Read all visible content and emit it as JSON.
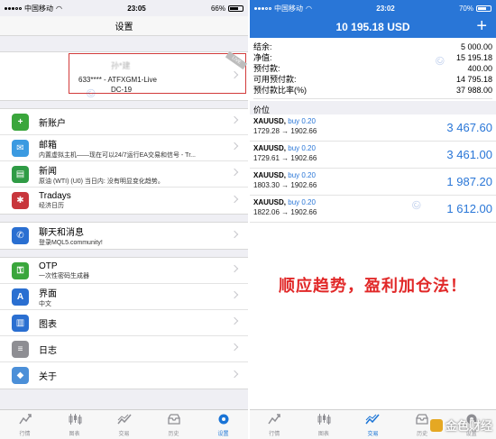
{
  "left": {
    "status": {
      "carrier": "中国移动",
      "time": "23:05",
      "battery": "66%",
      "battery_level": 0.66
    },
    "nav_title": "设置",
    "account": {
      "name": "孙*建",
      "line": "633**** - ATFXGM1-Live",
      "server": "DC-19",
      "ribbon": "LIVE"
    },
    "group1": [
      {
        "title": "新账户",
        "sub": "",
        "icon": "add-user-icon",
        "color": "#3aa63c",
        "glyph": "+"
      },
      {
        "title": "邮箱",
        "sub": "内置虚拟主机——现在可以24/7运行EA交易和信号 - Tr...",
        "icon": "mail-icon",
        "color": "#3b9ae1",
        "glyph": "✉"
      },
      {
        "title": "新闻",
        "sub": "原油 (WTI) (U0) 当日内: 没有明显变化趋势。",
        "icon": "news-icon",
        "color": "#2f9b45",
        "glyph": "▤"
      },
      {
        "title": "Tradays",
        "sub": "经济日历",
        "icon": "tradays-icon",
        "color": "#c8363c",
        "glyph": "✱"
      }
    ],
    "group2": [
      {
        "title": "聊天和消息",
        "sub": "登录MQL5.community!",
        "icon": "chat-icon",
        "color": "#2a6fd1",
        "glyph": "✆"
      }
    ],
    "group3": [
      {
        "title": "OTP",
        "sub": "一次性密码生成器",
        "icon": "key-icon",
        "color": "#3aa63c",
        "glyph": "⚿"
      },
      {
        "title": "界面",
        "sub": "中文",
        "icon": "language-icon",
        "color": "#2a6fd1",
        "glyph": "A"
      },
      {
        "title": "图表",
        "sub": "",
        "icon": "chart-icon",
        "color": "#2a6fd1",
        "glyph": "▥"
      },
      {
        "title": "日志",
        "sub": "",
        "icon": "journal-icon",
        "color": "#8e8e93",
        "glyph": "≡"
      },
      {
        "title": "关于",
        "sub": "",
        "icon": "about-icon",
        "color": "#4b8fd8",
        "glyph": "◆"
      }
    ],
    "tabs": [
      {
        "label": "行情",
        "icon": "quotes-icon",
        "active": false
      },
      {
        "label": "图表",
        "icon": "candles-icon",
        "active": false
      },
      {
        "label": "交易",
        "icon": "trade-icon",
        "active": false
      },
      {
        "label": "历史",
        "icon": "history-icon",
        "active": false
      },
      {
        "label": "设置",
        "icon": "settings-icon",
        "active": true
      }
    ]
  },
  "right": {
    "status": {
      "carrier": "中国移动",
      "time": "23:02",
      "battery": "70%",
      "battery_level": 0.7
    },
    "balance": "10 195.18 USD",
    "plus": "+",
    "summary": [
      {
        "label": "结余:",
        "value": "5 000.00"
      },
      {
        "label": "净值:",
        "value": "15 195.18"
      },
      {
        "label": "预付款:",
        "value": "400.00"
      },
      {
        "label": "可用预付款:",
        "value": "14 795.18"
      },
      {
        "label": "预付款比率(%)",
        "value": "37 988.00"
      }
    ],
    "price_header": "价位",
    "positions": [
      {
        "symbol": "XAUUSD,",
        "action": "buy 0.20",
        "prices": "1729.28 → 1902.66",
        "profit": "3 467.60"
      },
      {
        "symbol": "XAUUSD,",
        "action": "buy 0.20",
        "prices": "1729.61 → 1902.66",
        "profit": "3 461.00"
      },
      {
        "symbol": "XAUUSD,",
        "action": "buy 0.20",
        "prices": "1803.30 → 1902.66",
        "profit": "1 987.20"
      },
      {
        "symbol": "XAUUSD,",
        "action": "buy 0.20",
        "prices": "1822.06 → 1902.66",
        "profit": "1 612.00"
      }
    ],
    "tagline": "顺应趋势，盈利加仓法！",
    "tabs": [
      {
        "label": "行情",
        "icon": "quotes-icon",
        "active": false
      },
      {
        "label": "图表",
        "icon": "candles-icon",
        "active": false
      },
      {
        "label": "交易",
        "icon": "trade-icon",
        "active": true
      },
      {
        "label": "历史",
        "icon": "history-icon",
        "active": false
      },
      {
        "label": "设置",
        "icon": "settings-icon",
        "active": false
      }
    ],
    "watermark": "金色财经"
  },
  "colors": {
    "accent": "#2976d7",
    "tagline": "#e12828",
    "account_highlight": "#d23b3b"
  }
}
